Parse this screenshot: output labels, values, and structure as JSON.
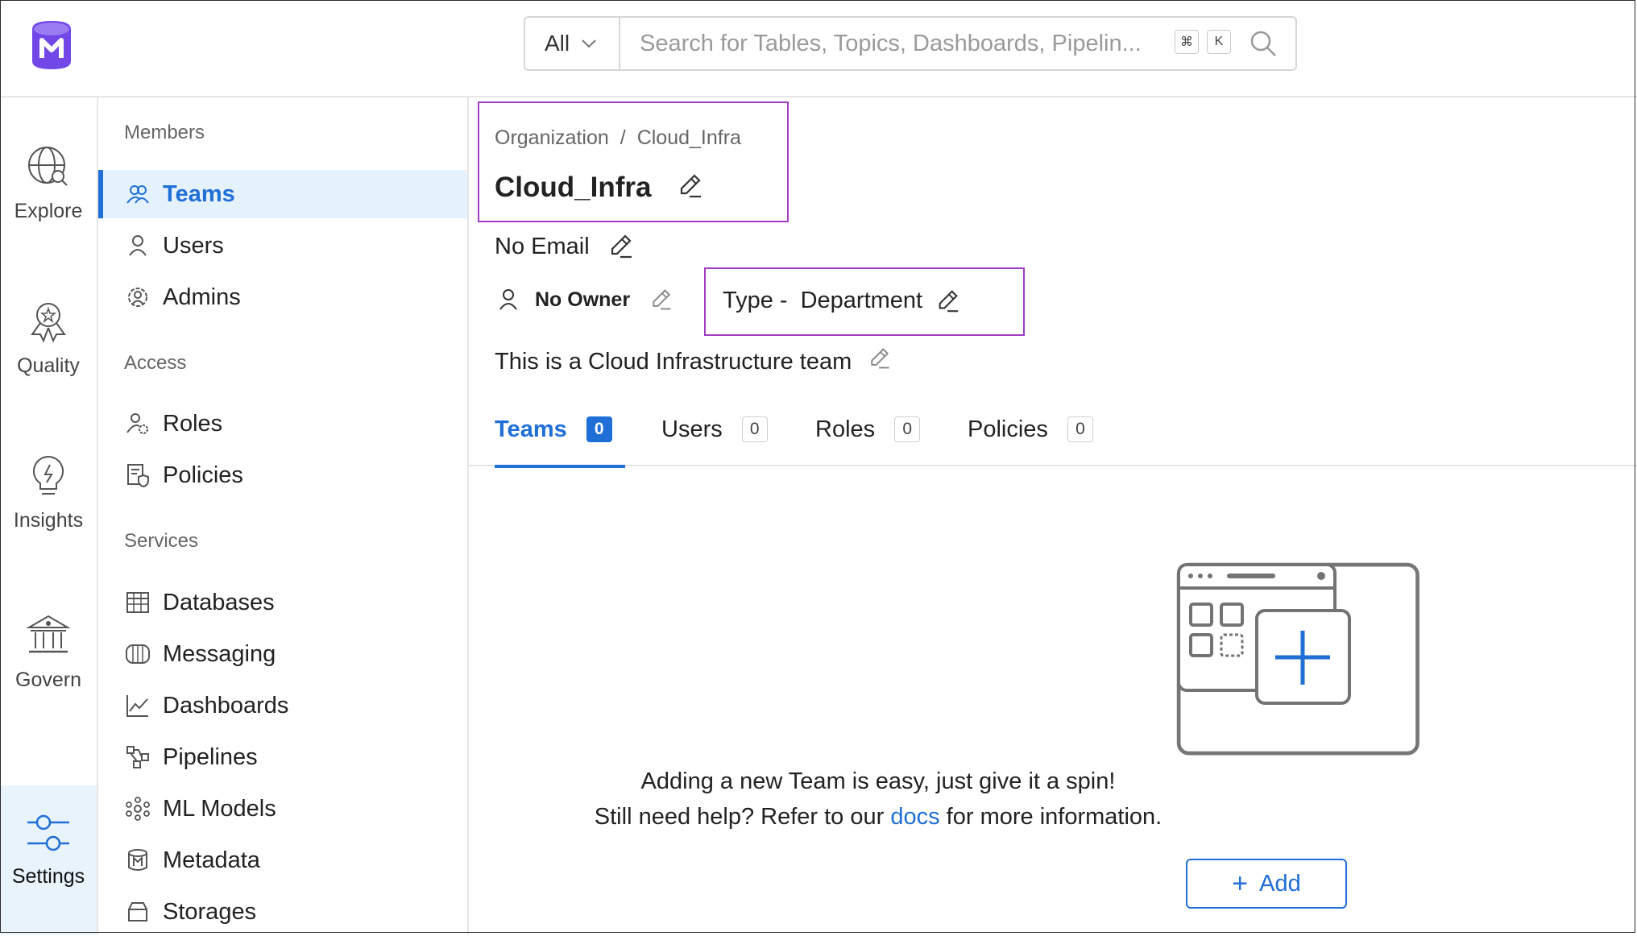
{
  "search": {
    "scope": "All",
    "placeholder": "Search for Tables, Topics, Dashboards, Pipelin...",
    "kbd_cmd": "⌘",
    "kbd_k": "K"
  },
  "leftnav": [
    {
      "label": "Explore",
      "icon": "explore-icon"
    },
    {
      "label": "Quality",
      "icon": "quality-icon"
    },
    {
      "label": "Insights",
      "icon": "insights-icon"
    },
    {
      "label": "Govern",
      "icon": "govern-icon"
    },
    {
      "label": "Settings",
      "icon": "settings-icon",
      "active": true
    }
  ],
  "sidebar": {
    "sections": [
      "Members",
      "Access",
      "Services"
    ],
    "members": [
      "Teams",
      "Users",
      "Admins"
    ],
    "access": [
      "Roles",
      "Policies"
    ],
    "services": [
      "Databases",
      "Messaging",
      "Dashboards",
      "Pipelines",
      "ML Models",
      "Metadata",
      "Storages"
    ]
  },
  "breadcrumb": {
    "root": "Organization",
    "separator": "/",
    "current": "Cloud_Infra"
  },
  "team": {
    "name": "Cloud_Infra",
    "email": "No Email",
    "owner": "No Owner",
    "type_label": "Type -",
    "type_value": "Department",
    "description": "This is a Cloud Infrastructure team"
  },
  "tabs": [
    {
      "label": "Teams",
      "count": "0",
      "active": true
    },
    {
      "label": "Users",
      "count": "0"
    },
    {
      "label": "Roles",
      "count": "0"
    },
    {
      "label": "Policies",
      "count": "0"
    }
  ],
  "empty": {
    "line1": "Adding a new Team is easy, just give it a spin!",
    "line2_pre": "Still need help? Refer to our",
    "line2_link": "docs",
    "line2_post": "for more information.",
    "button": "Add"
  },
  "colors": {
    "accent": "#1f6fd6",
    "highlight": "#a23cc5",
    "logo": "#7147e8"
  }
}
